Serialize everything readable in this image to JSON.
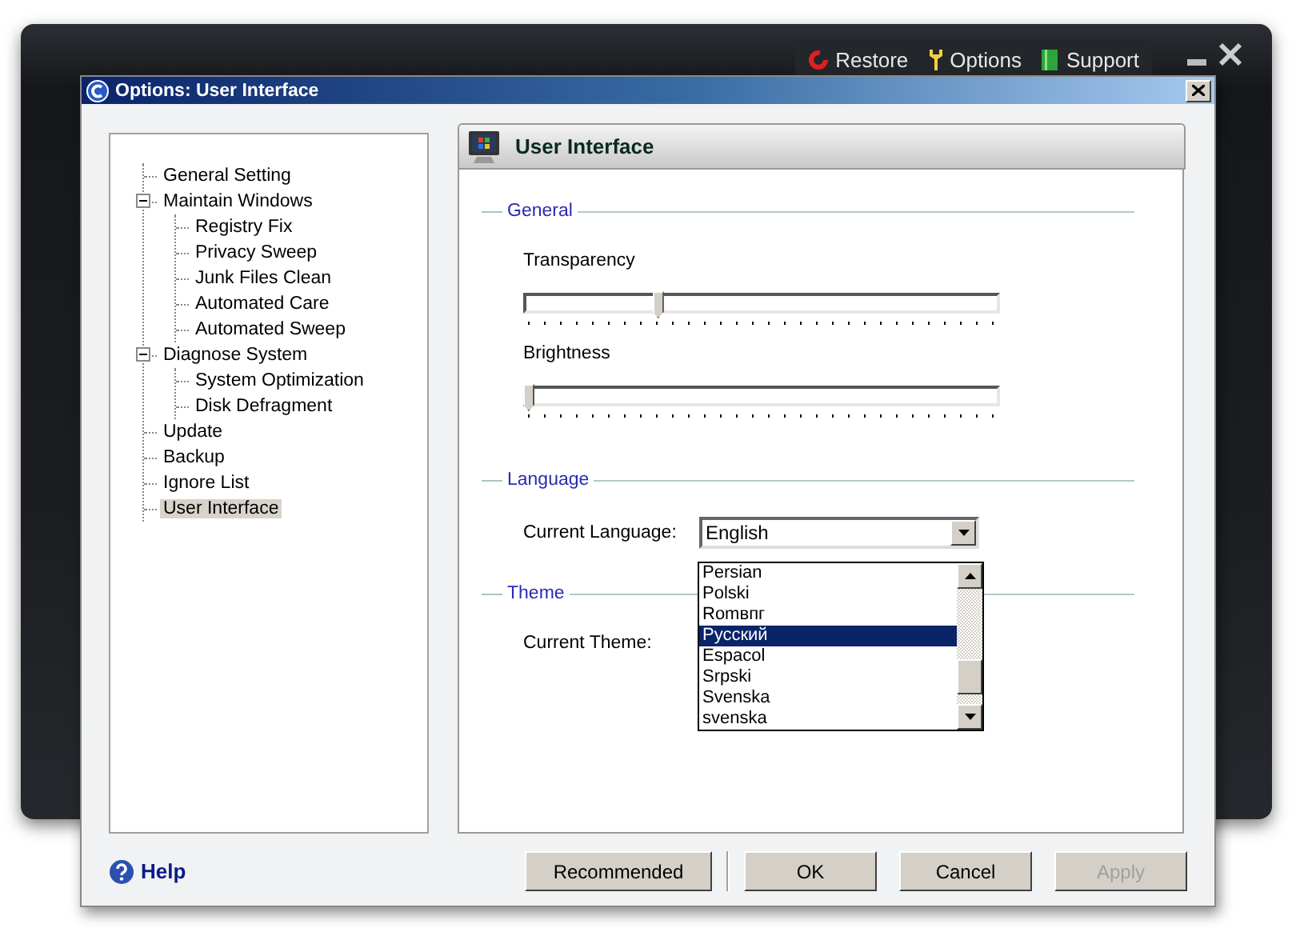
{
  "background_app": {
    "toolbar": [
      {
        "label": "Restore",
        "kind": "restore"
      },
      {
        "label": "Options",
        "kind": "options"
      },
      {
        "label": "Support",
        "kind": "support"
      }
    ]
  },
  "dialog": {
    "title": "Options: User Interface"
  },
  "tree": [
    {
      "label": "General Setting",
      "selected": false
    },
    {
      "label": "Maintain Windows",
      "selected": false,
      "expanded": true,
      "children": [
        {
          "label": "Registry Fix",
          "selected": false
        },
        {
          "label": "Privacy Sweep",
          "selected": false
        },
        {
          "label": "Junk Files Clean",
          "selected": false
        },
        {
          "label": "Automated Care",
          "selected": false
        },
        {
          "label": "Automated Sweep",
          "selected": false
        }
      ]
    },
    {
      "label": "Diagnose System",
      "selected": false,
      "expanded": true,
      "children": [
        {
          "label": "System Optimization",
          "selected": false
        },
        {
          "label": "Disk Defragment",
          "selected": false
        }
      ]
    },
    {
      "label": "Update",
      "selected": false
    },
    {
      "label": "Backup",
      "selected": false
    },
    {
      "label": "Ignore List",
      "selected": false
    },
    {
      "label": "User Interface",
      "selected": true
    }
  ],
  "panel": {
    "title": "User Interface",
    "general": {
      "title": "General",
      "sliders": [
        {
          "label": "Transparency",
          "level": 0.28
        },
        {
          "label": "Brightness",
          "level": 0
        }
      ]
    },
    "language": {
      "title": "Language",
      "label": "Current Language:",
      "value": "English",
      "open": true,
      "options": [
        {
          "label": "Persian",
          "selected": false
        },
        {
          "label": "Polski",
          "selected": false
        },
        {
          "label": "Romвпг",
          "selected": false
        },
        {
          "label": "Русский",
          "selected": true
        },
        {
          "label": "Espacol",
          "selected": false
        },
        {
          "label": "Srpski",
          "selected": false
        },
        {
          "label": "Svenska",
          "selected": false
        },
        {
          "label": "svenska",
          "selected": false
        }
      ]
    },
    "theme": {
      "title": "Theme",
      "label": "Current Theme:"
    }
  },
  "footer": {
    "help": "Help",
    "buttons": [
      {
        "label": "Recommended",
        "disabled": false,
        "separator_after": true
      },
      {
        "label": "OK",
        "disabled": false
      },
      {
        "label": "Cancel",
        "disabled": false
      },
      {
        "label": "Apply",
        "disabled": true
      }
    ]
  }
}
